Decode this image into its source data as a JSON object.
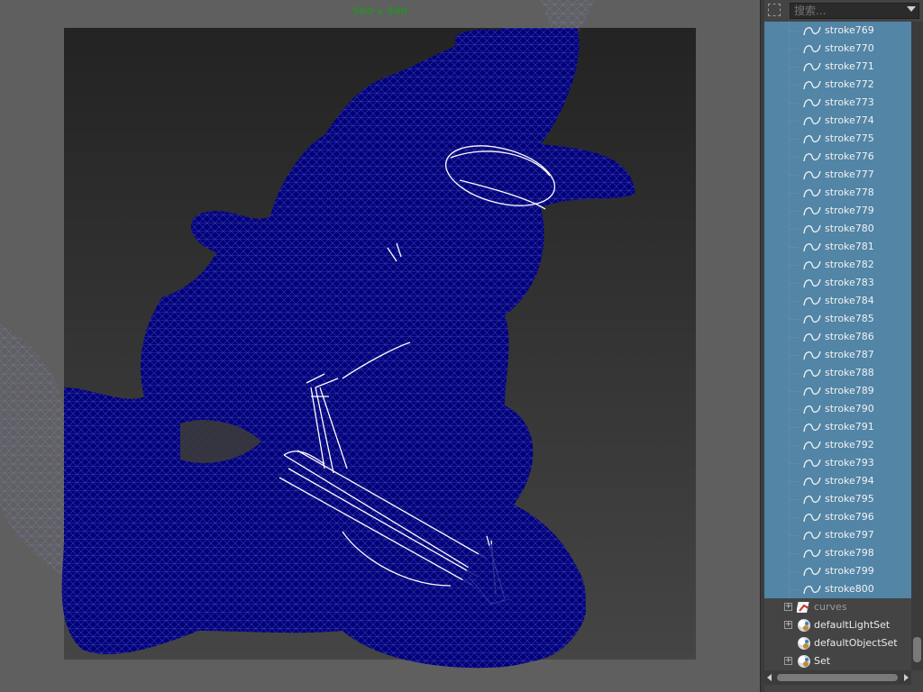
{
  "viewport": {
    "resolution_label": "500 x 500",
    "wireframe_color": "#000080",
    "highlight_color": "#ffffff"
  },
  "outliner": {
    "search_placeholder": "搜索...",
    "selection_color": "#5285a6",
    "stroke_items": [
      "stroke769",
      "stroke770",
      "stroke771",
      "stroke772",
      "stroke773",
      "stroke774",
      "stroke775",
      "stroke776",
      "stroke777",
      "stroke778",
      "stroke779",
      "stroke780",
      "stroke781",
      "stroke782",
      "stroke783",
      "stroke784",
      "stroke785",
      "stroke786",
      "stroke787",
      "stroke788",
      "stroke789",
      "stroke790",
      "stroke791",
      "stroke792",
      "stroke793",
      "stroke794",
      "stroke795",
      "stroke796",
      "stroke797",
      "stroke798",
      "stroke799",
      "stroke800"
    ],
    "sets": [
      {
        "label": "curves",
        "icon": "curves-set-icon",
        "expandable": true,
        "dimmed": true
      },
      {
        "label": "defaultLightSet",
        "icon": "light-set-icon",
        "expandable": true,
        "dimmed": false
      },
      {
        "label": "defaultObjectSet",
        "icon": "object-set-icon",
        "expandable": false,
        "dimmed": false
      },
      {
        "label": "Set",
        "icon": "set-icon",
        "expandable": true,
        "dimmed": false
      }
    ]
  }
}
